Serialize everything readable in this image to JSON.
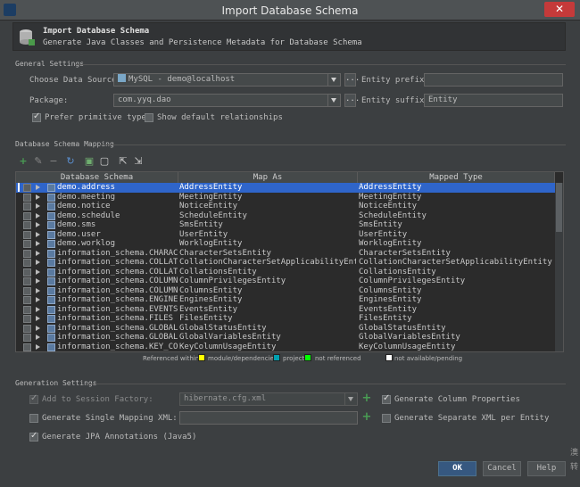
{
  "window": {
    "title": "Import Database Schema",
    "close_label": "✕"
  },
  "header": {
    "title": "Import Database Schema",
    "subtitle": "Generate Java Classes and Persistence Metadata for Database Schema"
  },
  "general_settings": {
    "section_label": "General Settings",
    "data_source_label": "Choose Data Source:",
    "data_source_value": "MySQL - demo@localhost",
    "entity_prefix_label": "Entity prefix:",
    "entity_prefix_value": "",
    "package_label": "Package:",
    "package_value": "com.yyq.dao",
    "entity_suffix_label": "Entity suffix:",
    "entity_suffix_value": "Entity",
    "prefer_primitive_label": "Prefer primitive types",
    "prefer_primitive_checked": true,
    "show_default_rel_label": "Show default relationships",
    "show_default_rel_checked": false,
    "dots_label": "..."
  },
  "mapping": {
    "section_label": "Database Schema Mapping",
    "columns": [
      "Database Schema",
      "Map As",
      "Mapped Type"
    ],
    "rows": [
      {
        "schema": "demo.address",
        "map_as": "AddressEntity",
        "type": "AddressEntity",
        "selected": true
      },
      {
        "schema": "demo.meeting",
        "map_as": "MeetingEntity",
        "type": "MeetingEntity"
      },
      {
        "schema": "demo.notice",
        "map_as": "NoticeEntity",
        "type": "NoticeEntity"
      },
      {
        "schema": "demo.schedule",
        "map_as": "ScheduleEntity",
        "type": "ScheduleEntity"
      },
      {
        "schema": "demo.sms",
        "map_as": "SmsEntity",
        "type": "SmsEntity"
      },
      {
        "schema": "demo.user",
        "map_as": "UserEntity",
        "type": "UserEntity"
      },
      {
        "schema": "demo.worklog",
        "map_as": "WorklogEntity",
        "type": "WorklogEntity"
      },
      {
        "schema": "information_schema.CHARACTER_S",
        "map_as": "CharacterSetsEntity",
        "type": "CharacterSetsEntity"
      },
      {
        "schema": "information_schema.COLLATION_C",
        "map_as": "CollationCharacterSetApplicabilityEntity",
        "type": "CollationCharacterSetApplicabilityEntity"
      },
      {
        "schema": "information_schema.COLLATIONS",
        "map_as": "CollationsEntity",
        "type": "CollationsEntity"
      },
      {
        "schema": "information_schema.COLUMN_PRIV",
        "map_as": "ColumnPrivilegesEntity",
        "type": "ColumnPrivilegesEntity"
      },
      {
        "schema": "information_schema.COLUMNS",
        "map_as": "ColumnsEntity",
        "type": "ColumnsEntity"
      },
      {
        "schema": "information_schema.ENGINES",
        "map_as": "EnginesEntity",
        "type": "EnginesEntity"
      },
      {
        "schema": "information_schema.EVENTS",
        "map_as": "EventsEntity",
        "type": "EventsEntity"
      },
      {
        "schema": "information_schema.FILES",
        "map_as": "FilesEntity",
        "type": "FilesEntity"
      },
      {
        "schema": "information_schema.GLOBAL_STAT",
        "map_as": "GlobalStatusEntity",
        "type": "GlobalStatusEntity"
      },
      {
        "schema": "information_schema.GLOBAL_VARI",
        "map_as": "GlobalVariablesEntity",
        "type": "GlobalVariablesEntity"
      },
      {
        "schema": "information_schema.KEY_COLUMN_",
        "map_as": "KeyColumnUsageEntity",
        "type": "KeyColumnUsageEntity"
      }
    ],
    "legend": {
      "prefix": "Referenced within:",
      "items": [
        {
          "label": "module/dependencies",
          "color": "#ffff00"
        },
        {
          "label": "project",
          "color": "#00a0b0"
        },
        {
          "label": "not referenced",
          "color": "#00ff00"
        },
        {
          "label": "not available/pending",
          "color": "#ffffff"
        }
      ]
    }
  },
  "generation": {
    "section_label": "Generation Settings",
    "add_session_label": "Add to Session Factory:",
    "add_session_checked": true,
    "session_value": "hibernate.cfg.xml",
    "gen_column_props_label": "Generate Column Properties",
    "gen_column_props_checked": true,
    "gen_single_mapping_label": "Generate Single Mapping XML:",
    "gen_single_mapping_checked": false,
    "gen_separate_xml_label": "Generate Separate XML per Entity",
    "gen_separate_xml_checked": false,
    "gen_jpa_label": "Generate JPA Annotations (Java5)",
    "gen_jpa_checked": true
  },
  "buttons": {
    "ok": "OK",
    "cancel": "Cancel",
    "help": "Help"
  },
  "side_glyphs": [
    "澳",
    "转"
  ],
  "colors": {
    "background": "#3c3f41",
    "selection": "#2f65ca",
    "accent_green": "#499c54",
    "primary_button": "#365880"
  }
}
